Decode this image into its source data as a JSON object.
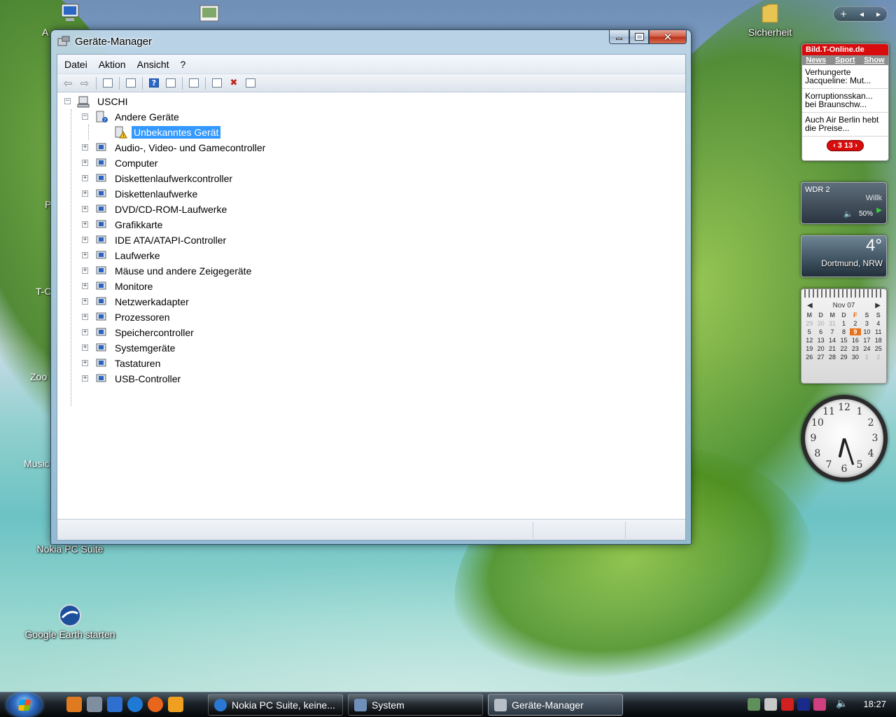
{
  "desktop": {
    "icons": [
      {
        "label": ""
      },
      {
        "label": ""
      },
      {
        "label": "Sicherheit"
      },
      {
        "label": "Nokia PC Suite"
      },
      {
        "label": "Google Earth starten"
      }
    ],
    "clipped_labels": [
      "A",
      "P",
      "T-C",
      "Zoo",
      "Music"
    ]
  },
  "window": {
    "title": "Geräte-Manager",
    "close_glyph": "✕",
    "menu": [
      "Datei",
      "Aktion",
      "Ansicht",
      "?"
    ],
    "toolbar": [
      {
        "icon": "back-arrow-icon"
      },
      {
        "icon": "forward-arrow-icon"
      },
      {
        "icon": "show-hide-console-tree-icon"
      },
      {
        "icon": "properties-icon"
      },
      {
        "icon": "help-icon",
        "glyph": "?"
      },
      {
        "icon": "view-icon"
      },
      {
        "icon": "scan-hardware-changes-icon"
      },
      {
        "icon": "update-driver-icon"
      },
      {
        "icon": "uninstall-icon"
      },
      {
        "icon": "disable-device-icon"
      }
    ],
    "tree": {
      "root": "USCHI",
      "expanded_category": "Andere Geräte",
      "selected_device": "Unbekanntes Gerät",
      "categories": [
        "Audio-, Video- und Gamecontroller",
        "Computer",
        "Diskettenlaufwerkcontroller",
        "Diskettenlaufwerke",
        "DVD/CD-ROM-Laufwerke",
        "Grafikkarte",
        "IDE ATA/ATAPI-Controller",
        "Laufwerke",
        "Mäuse und andere Zeigegeräte",
        "Monitore",
        "Netzwerkadapter",
        "Prozessoren",
        "Speichercontroller",
        "Systemgeräte",
        "Tastaturen",
        "USB-Controller"
      ]
    }
  },
  "gadgets": {
    "news": {
      "source": "Bild.T-Online.de",
      "tabs": [
        "News",
        "Sport",
        "Show"
      ],
      "items": [
        "Verhungerte Jacqueline: Mut...",
        "Korruptionsskan... bei Braunschw...",
        "Auch Air Berlin hebt die Preise..."
      ],
      "pager": "‹ 3 13 ›"
    },
    "radio": {
      "station": "WDR 2",
      "ticker": "Willk",
      "volume": "50%"
    },
    "weather": {
      "temperature": "4°",
      "location": "Dortmund, NRW"
    },
    "calendar": {
      "month": "Nov 07",
      "weekdays": [
        "M",
        "D",
        "M",
        "D",
        "F",
        "S",
        "S"
      ],
      "today": "9",
      "days": [
        {
          "d": "29",
          "dim": true
        },
        {
          "d": "30",
          "dim": true
        },
        {
          "d": "31",
          "dim": true
        },
        {
          "d": "1"
        },
        {
          "d": "2"
        },
        {
          "d": "3"
        },
        {
          "d": "4"
        },
        {
          "d": "5"
        },
        {
          "d": "6"
        },
        {
          "d": "7"
        },
        {
          "d": "8"
        },
        {
          "d": "9",
          "today": true
        },
        {
          "d": "10"
        },
        {
          "d": "11"
        },
        {
          "d": "12"
        },
        {
          "d": "13"
        },
        {
          "d": "14"
        },
        {
          "d": "15"
        },
        {
          "d": "16"
        },
        {
          "d": "17"
        },
        {
          "d": "18"
        },
        {
          "d": "19"
        },
        {
          "d": "20"
        },
        {
          "d": "21"
        },
        {
          "d": "22"
        },
        {
          "d": "23"
        },
        {
          "d": "24"
        },
        {
          "d": "25"
        },
        {
          "d": "26"
        },
        {
          "d": "27"
        },
        {
          "d": "28"
        },
        {
          "d": "29"
        },
        {
          "d": "30"
        },
        {
          "d": "1",
          "dim": true
        },
        {
          "d": "2",
          "dim": true
        }
      ]
    },
    "clock": {
      "numbers": [
        "12",
        "1",
        "2",
        "3",
        "4",
        "5",
        "6",
        "7",
        "8",
        "9",
        "10",
        "11"
      ],
      "hour": 6,
      "minute": 27
    }
  },
  "sidebar_controls": {
    "add": "+",
    "prev": "◂",
    "next": "▸"
  },
  "taskbar": {
    "buttons": [
      {
        "label": "Nokia PC Suite, keine...",
        "active": false
      },
      {
        "label": "System",
        "active": false
      },
      {
        "label": "Geräte-Manager",
        "active": true
      }
    ],
    "clock": "18:27"
  },
  "colors": {
    "selection": "#3399ff",
    "news_brand": "#d80c0c",
    "calendar_today": "#e8701a"
  }
}
